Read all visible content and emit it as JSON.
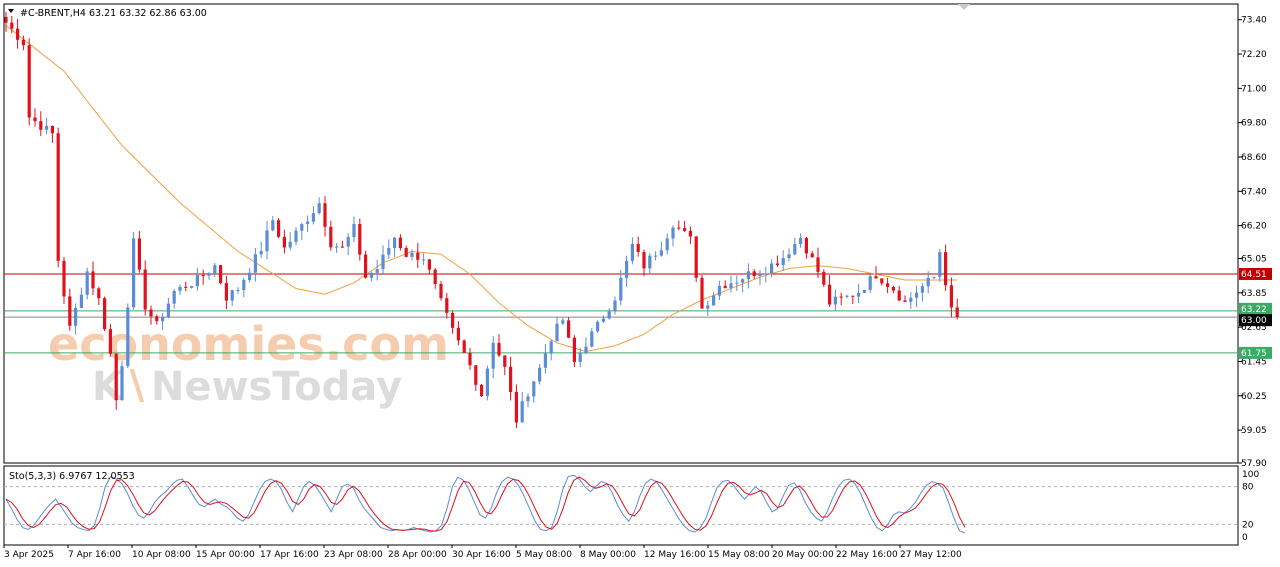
{
  "header": {
    "title": "#C-BRENT,H4",
    "ohlc": "63.21 63.32 62.86 63.00"
  },
  "indicator": {
    "label": "Sto(5,3,3) 6.9767 12.0553"
  },
  "watermark": {
    "brand_top": "economies.com",
    "brand_bottom": "NewsToday"
  },
  "colors": {
    "bull": "#5b8dd6",
    "bear": "#e0101c",
    "ma": "#f0a040",
    "resistance": "#c00000",
    "support": "#3caa64",
    "current": "#000000",
    "sto_main": "#5b8dd6",
    "sto_signal": "#e0101c"
  },
  "chart_data": [
    {
      "type": "candlestick",
      "symbol": "#C-BRENT",
      "timeframe": "H4",
      "y_ticks": [
        "73.40",
        "72.20",
        "71.00",
        "69.80",
        "68.60",
        "67.40",
        "66.20",
        "65.05",
        "63.85",
        "62.65",
        "61.45",
        "60.25",
        "59.05",
        "57.90"
      ],
      "ylim": [
        57.9,
        73.95
      ],
      "x_labels": [
        "3 Apr 2025",
        "7 Apr 16:00",
        "10 Apr 08:00",
        "15 Apr 00:00",
        "17 Apr 16:00",
        "23 Apr 08:00",
        "28 Apr 00:00",
        "30 Apr 16:00",
        "5 May 08:00",
        "8 May 00:00",
        "12 May 16:00",
        "15 May 08:00",
        "20 May 00:00",
        "22 May 16:00",
        "27 May 12:00"
      ],
      "horizontal_lines": [
        {
          "name": "resistance",
          "value": 64.51,
          "label": "64.51"
        },
        {
          "name": "bid",
          "value": 63.22,
          "label": "63.22"
        },
        {
          "name": "current",
          "value": 63.0,
          "label": "63.00"
        },
        {
          "name": "support",
          "value": 61.75,
          "label": "61.75"
        }
      ],
      "waypoints": [
        [
          0,
          73.3
        ],
        [
          3,
          72.6
        ],
        [
          4,
          70.0
        ],
        [
          8,
          69.4
        ],
        [
          9,
          65.0
        ],
        [
          11,
          62.6
        ],
        [
          14,
          64.6
        ],
        [
          16,
          63.6
        ],
        [
          17,
          62.7
        ],
        [
          18,
          61.7
        ],
        [
          19,
          60.1
        ],
        [
          20,
          61.4
        ],
        [
          22,
          65.6
        ],
        [
          24,
          63.4
        ],
        [
          26,
          62.7
        ],
        [
          29,
          63.9
        ],
        [
          33,
          64.3
        ],
        [
          36,
          64.8
        ],
        [
          38,
          63.7
        ],
        [
          40,
          64.0
        ],
        [
          44,
          65.4
        ],
        [
          46,
          66.4
        ],
        [
          48,
          65.4
        ],
        [
          51,
          66.2
        ],
        [
          54,
          67.0
        ],
        [
          56,
          65.6
        ],
        [
          58,
          65.4
        ],
        [
          60,
          66.1
        ],
        [
          62,
          64.4
        ],
        [
          64,
          64.7
        ],
        [
          67,
          65.8
        ],
        [
          69,
          65.2
        ],
        [
          72,
          65.1
        ],
        [
          75,
          63.5
        ],
        [
          77,
          62.5
        ],
        [
          80,
          61.3
        ],
        [
          82,
          60.3
        ],
        [
          84,
          62.2
        ],
        [
          86,
          61.2
        ],
        [
          88,
          59.4
        ],
        [
          90,
          60.4
        ],
        [
          92,
          61.2
        ],
        [
          94,
          62.3
        ],
        [
          96,
          62.9
        ],
        [
          98,
          61.4
        ],
        [
          100,
          62.1
        ],
        [
          102,
          62.7
        ],
        [
          105,
          63.7
        ],
        [
          108,
          65.5
        ],
        [
          110,
          64.8
        ],
        [
          113,
          65.5
        ],
        [
          115,
          66.3
        ],
        [
          118,
          65.7
        ],
        [
          120,
          63.3
        ],
        [
          123,
          64.1
        ],
        [
          126,
          64.3
        ],
        [
          128,
          64.5
        ],
        [
          131,
          64.7
        ],
        [
          134,
          65.1
        ],
        [
          137,
          65.8
        ],
        [
          140,
          64.6
        ],
        [
          142,
          63.5
        ],
        [
          145,
          63.7
        ],
        [
          147,
          63.9
        ],
        [
          150,
          64.5
        ],
        [
          153,
          64.0
        ],
        [
          155,
          63.5
        ],
        [
          157,
          63.9
        ],
        [
          160,
          64.4
        ],
        [
          161,
          65.3
        ],
        [
          163,
          63.2
        ],
        [
          164,
          63.0
        ]
      ],
      "ma_points": [
        [
          0,
          73.2
        ],
        [
          10,
          71.6
        ],
        [
          20,
          69.0
        ],
        [
          30,
          67.0
        ],
        [
          40,
          65.3
        ],
        [
          50,
          64.0
        ],
        [
          55,
          63.8
        ],
        [
          60,
          64.2
        ],
        [
          65,
          64.9
        ],
        [
          70,
          65.3
        ],
        [
          75,
          65.2
        ],
        [
          80,
          64.5
        ],
        [
          85,
          63.5
        ],
        [
          90,
          62.7
        ],
        [
          95,
          62.1
        ],
        [
          100,
          61.8
        ],
        [
          105,
          62.0
        ],
        [
          110,
          62.4
        ],
        [
          115,
          63.1
        ],
        [
          120,
          63.6
        ],
        [
          125,
          64.0
        ],
        [
          130,
          64.4
        ],
        [
          135,
          64.7
        ],
        [
          140,
          64.8
        ],
        [
          145,
          64.7
        ],
        [
          150,
          64.5
        ],
        [
          155,
          64.3
        ],
        [
          160,
          64.3
        ],
        [
          164,
          64.3
        ]
      ]
    },
    {
      "type": "line",
      "name": "stochastic",
      "ylim": [
        0,
        100
      ],
      "y_ticks": [
        "100",
        "80",
        "20",
        "0"
      ],
      "levels": [
        80,
        20
      ],
      "series": [
        {
          "name": "main",
          "values": [
            60,
            45,
            28,
            15,
            12,
            18,
            30,
            42,
            52,
            60,
            48,
            35,
            22,
            15,
            12,
            10,
            18,
            45,
            80,
            96,
            92,
            85,
            70,
            50,
            35,
            30,
            40,
            55,
            65,
            72,
            82,
            90,
            92,
            80,
            65,
            52,
            48,
            55,
            60,
            52,
            48,
            40,
            30,
            25,
            35,
            55,
            75,
            88,
            92,
            88,
            75,
            55,
            40,
            60,
            80,
            88,
            82,
            70,
            55,
            40,
            60,
            80,
            84,
            78,
            60,
            45,
            35,
            25,
            15,
            12,
            10,
            12,
            10,
            12,
            15,
            12,
            10,
            8,
            10,
            18,
            45,
            80,
            95,
            90,
            75,
            55,
            35,
            30,
            45,
            70,
            88,
            95,
            92,
            82,
            65,
            45,
            25,
            12,
            10,
            15,
            40,
            75,
            96,
            98,
            92,
            80,
            72,
            80,
            88,
            85,
            70,
            50,
            35,
            25,
            40,
            65,
            85,
            92,
            88,
            75,
            60,
            45,
            30,
            18,
            10,
            8,
            15,
            30,
            55,
            78,
            88,
            90,
            82,
            70,
            60,
            70,
            80,
            72,
            55,
            40,
            45,
            65,
            82,
            86,
            75,
            55,
            40,
            30,
            25,
            40,
            62,
            80,
            90,
            92,
            85,
            70,
            50,
            30,
            15,
            10,
            20,
            35,
            40,
            38,
            45,
            55,
            70,
            82,
            88,
            85,
            78,
            55,
            30,
            10,
            6
          ]
        }
      ]
    }
  ]
}
